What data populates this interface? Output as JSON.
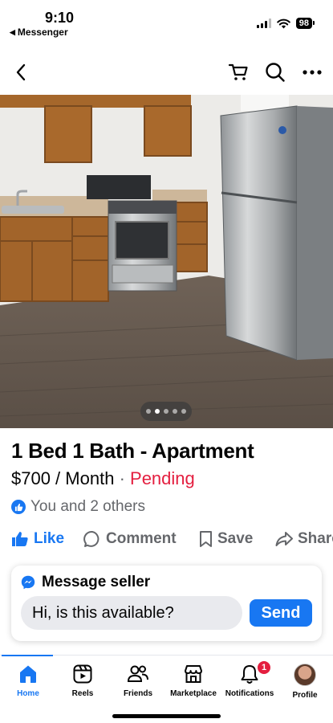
{
  "status_bar": {
    "time": "9:10",
    "back_app": "Messenger",
    "battery": "98"
  },
  "nav": {
    "icons": [
      "back-icon",
      "cart-icon",
      "search-icon",
      "more-icon"
    ]
  },
  "photo": {
    "image_count": 5,
    "active_index": 1
  },
  "listing": {
    "title": "1 Bed 1 Bath - Apartment",
    "price": "$700 / Month",
    "separator": "·",
    "status": "Pending",
    "reactions_text": "You and 2 others"
  },
  "actions": {
    "like": "Like",
    "comment": "Comment",
    "save": "Save",
    "share": "Share"
  },
  "message": {
    "header": "Message seller",
    "input_value": "Hi, is this available?",
    "send": "Send"
  },
  "tabs": [
    {
      "label": "Home",
      "icon": "home-icon",
      "active": true
    },
    {
      "label": "Reels",
      "icon": "reels-icon"
    },
    {
      "label": "Friends",
      "icon": "friends-icon"
    },
    {
      "label": "Marketplace",
      "icon": "marketplace-icon"
    },
    {
      "label": "Notifications",
      "icon": "bell-icon",
      "badge": "1"
    },
    {
      "label": "Profile",
      "icon": "avatar"
    }
  ],
  "colors": {
    "accent": "#1877f2",
    "pending": "#e41e3f",
    "muted": "#65676b"
  }
}
